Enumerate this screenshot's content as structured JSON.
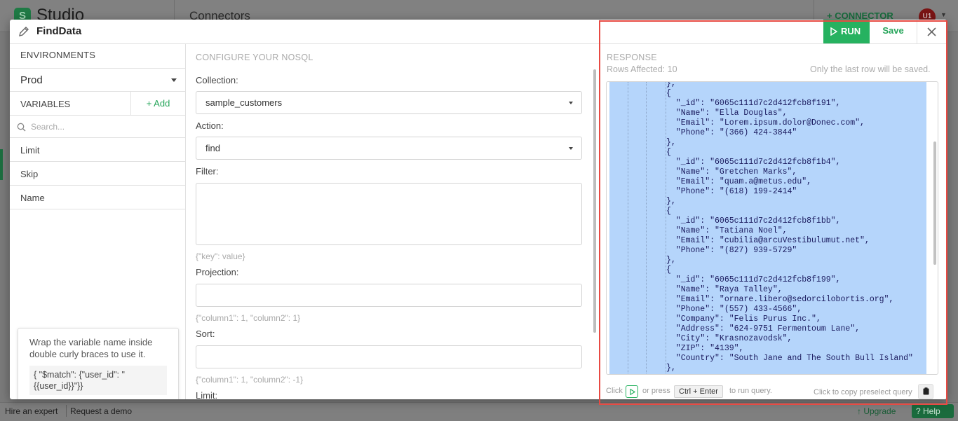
{
  "background": {
    "logo_letter": "S",
    "app_name": "Studio",
    "page_title": "Connectors",
    "add_connector": "+ CONNECTOR",
    "avatar": "U1",
    "hire_expert": "Hire an expert",
    "request_demo": "Request a demo",
    "upgrade": "↑ Upgrade",
    "help": "? Help"
  },
  "modal": {
    "title": "FindData",
    "environments_label": "ENVIRONMENTS",
    "environment_value": "Prod",
    "variables_label": "VARIABLES",
    "add_label": "+ Add",
    "search_placeholder": "Search...",
    "variables": [
      "Limit",
      "Skip",
      "Name"
    ],
    "hint": {
      "text": "Wrap the variable name inside double curly braces to use it.",
      "code": "{ \"$match\": {\"user_id\": \"{{user_id}}\"}}"
    },
    "configure": {
      "title": "CONFIGURE YOUR NOSQL",
      "collection_label": "Collection:",
      "collection_value": "sample_customers",
      "action_label": "Action:",
      "action_value": "find",
      "filter_label": "Filter:",
      "filter_hint": "{\"key\": value}",
      "projection_label": "Projection:",
      "projection_hint": "{\"column1\": 1, \"column2\": 1}",
      "sort_label": "Sort:",
      "sort_hint": "{\"column1\": 1, \"column2\": -1}",
      "limit_label": "Limit:"
    },
    "response": {
      "run_label": "RUN",
      "save_label": "Save",
      "title": "RESPONSE",
      "rows_affected": "Rows Affected: 10",
      "note": "Only the last row will be saved.",
      "code_lines": [
        "},",
        "{",
        "  \"_id\": \"6065c111d7c2d412fcb8f191\",",
        "  \"Name\": \"Ella Douglas\",",
        "  \"Email\": \"Lorem.ipsum.dolor@Donec.com\",",
        "  \"Phone\": \"(366) 424-3844\"",
        "},",
        "{",
        "  \"_id\": \"6065c111d7c2d412fcb8f1b4\",",
        "  \"Name\": \"Gretchen Marks\",",
        "  \"Email\": \"quam.a@metus.edu\",",
        "  \"Phone\": \"(618) 199-2414\"",
        "},",
        "{",
        "  \"_id\": \"6065c111d7c2d412fcb8f1bb\",",
        "  \"Name\": \"Tatiana Noel\",",
        "  \"Email\": \"cubilia@arcuVestibulumut.net\",",
        "  \"Phone\": \"(827) 939-5729\"",
        "},",
        "{",
        "  \"_id\": \"6065c111d7c2d412fcb8f199\",",
        "  \"Name\": \"Raya Talley\",",
        "  \"Email\": \"ornare.libero@sedorcilobortis.org\",",
        "  \"Phone\": \"(557) 433-4566\",",
        "  \"Company\": \"Felis Purus Inc.\",",
        "  \"Address\": \"624-9751 Fermentoum Lane\",",
        "  \"City\": \"Krasnozavodsk\",",
        "  \"ZIP\": \"4139\",",
        "  \"Country\": \"South Jane and The South Bull Island\"",
        "},"
      ],
      "footer_click": "Click",
      "footer_or_press": "or press",
      "footer_shortcut": "Ctrl + Enter",
      "footer_to_run": "to run query.",
      "footer_copy": "Click to copy preselect query"
    }
  },
  "colors": {
    "accent_green": "#26b260",
    "highlight_red": "#e84a43",
    "selection_blue": "#b5d5fb"
  }
}
